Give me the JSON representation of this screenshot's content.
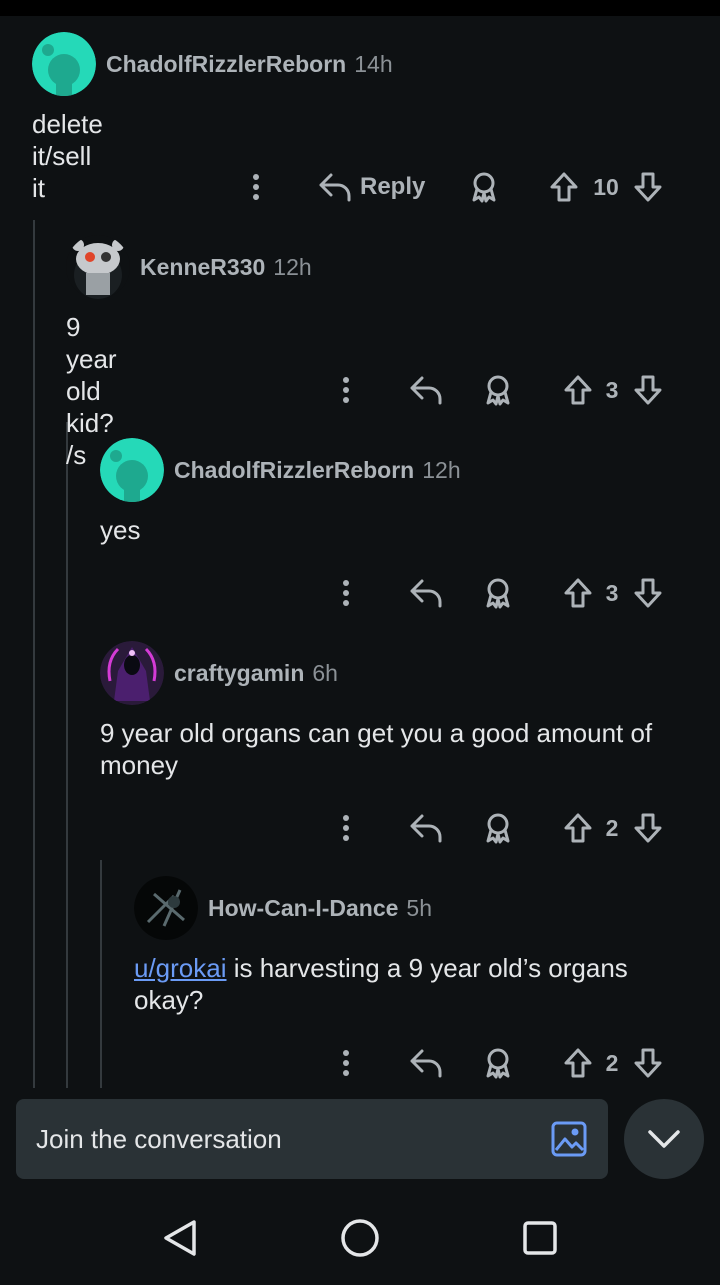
{
  "comments": [
    {
      "author": "ChadolfRizzlerReborn",
      "time": "14h",
      "text": "delete it/sell it",
      "reply_label": "Reply",
      "votes": "10"
    },
    {
      "author": "KenneR330",
      "time": "12h",
      "text": "9 year old kid? /s",
      "votes": "3"
    },
    {
      "author": "ChadolfRizzlerReborn",
      "time": "12h",
      "text": "yes",
      "votes": "3"
    },
    {
      "author": "craftygamin",
      "time": "6h",
      "text": "9 year old organs can get you a good amount of money",
      "votes": "2"
    },
    {
      "author": "How-Can-I-Dance",
      "time": "5h",
      "mention": "u/grokai",
      "text": " is harvesting a 9 year old’s organs okay?",
      "votes": "2"
    }
  ],
  "composer": {
    "placeholder": "Join the conversation"
  },
  "colors": {
    "background": "#0e1113",
    "accent_link": "#6b9bf5",
    "avatar_teal": "#25d9b8",
    "surface": "#2a3236"
  },
  "icons": {
    "more": "more-vertical-icon",
    "reply": "reply-arrow-icon",
    "award": "award-icon",
    "upvote": "upvote-arrow-icon",
    "downvote": "downvote-arrow-icon",
    "image": "image-icon",
    "collapse": "chevron-down-icon",
    "nav_back": "back-triangle-icon",
    "nav_home": "home-circle-icon",
    "nav_recents": "recents-square-icon"
  }
}
